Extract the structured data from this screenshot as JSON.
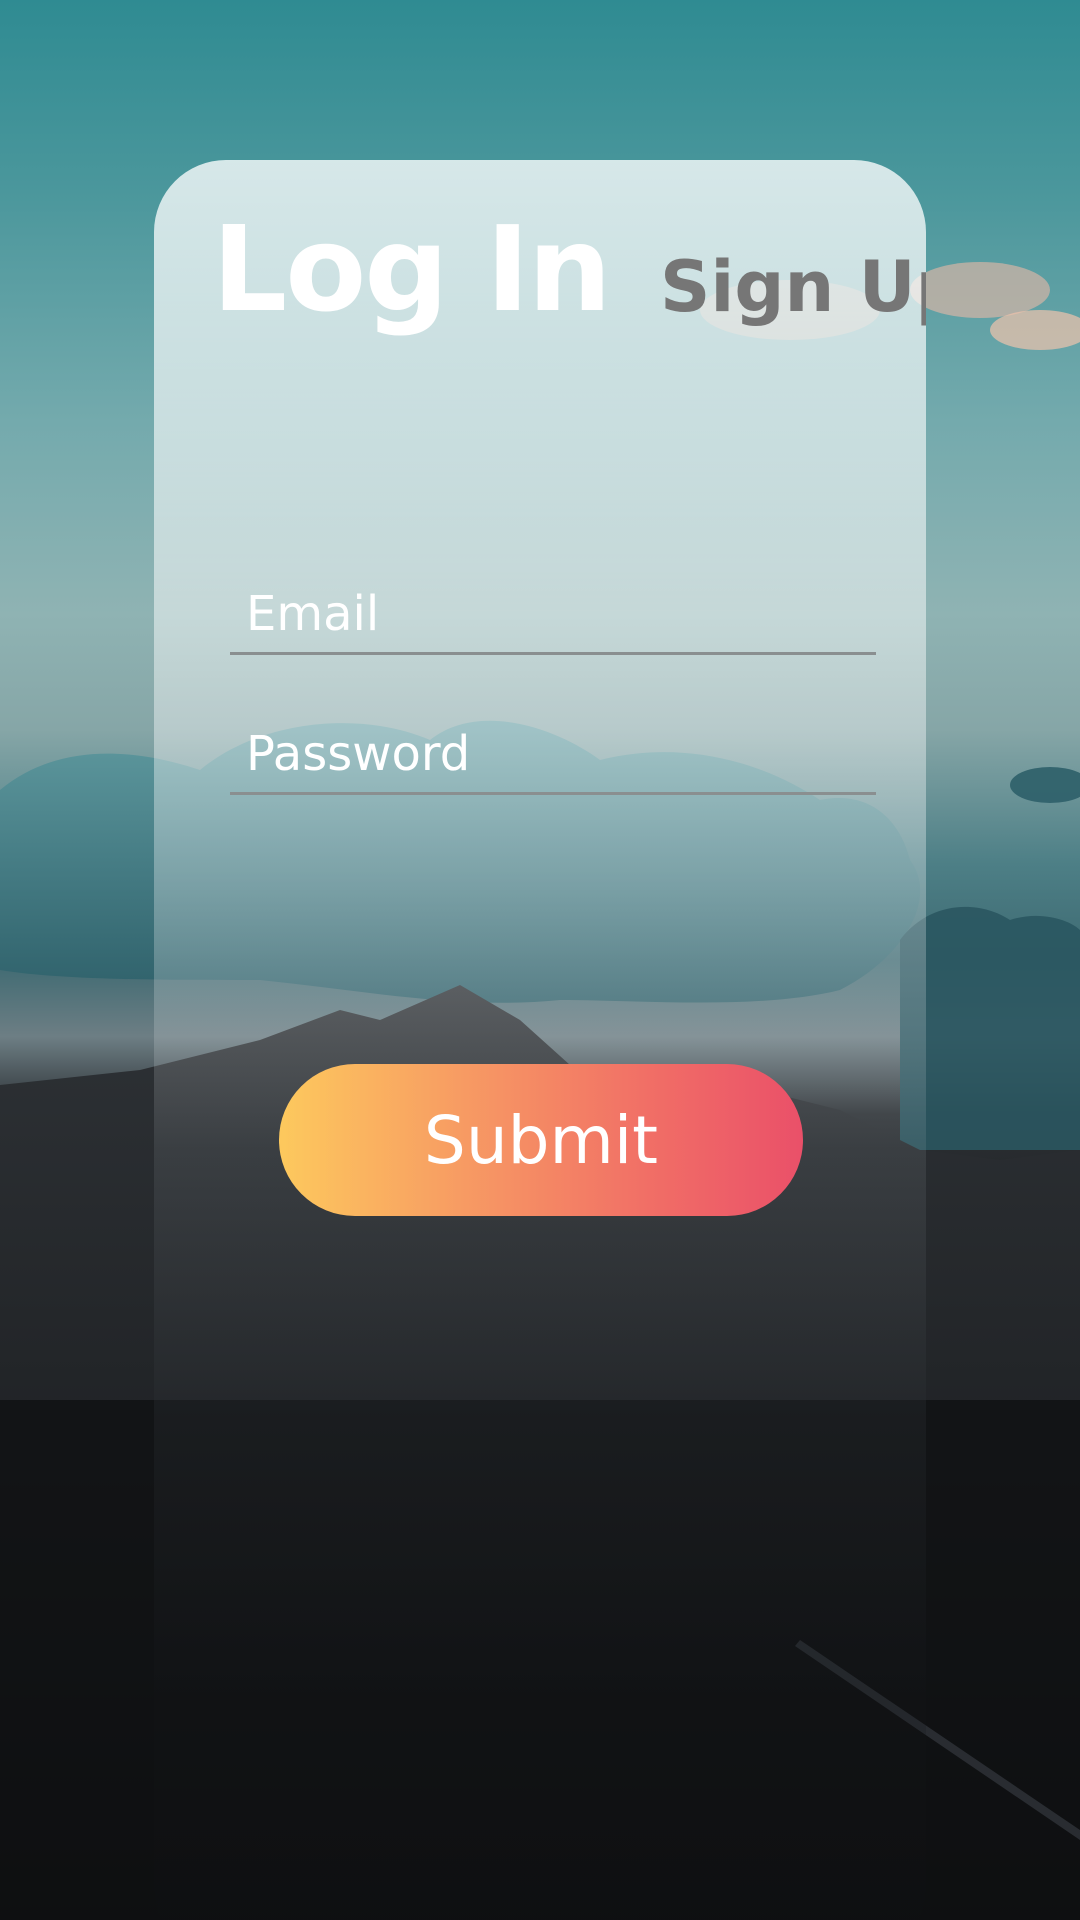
{
  "tabs": {
    "login_label": "Log In",
    "signup_label": "Sign Up"
  },
  "form": {
    "email_placeholder": "Email",
    "password_placeholder": "Password",
    "submit_label": "Submit"
  },
  "colors": {
    "submit_gradient_start": "#fdc95d",
    "submit_gradient_end": "#ea5069",
    "active_tab": "#ffffff",
    "inactive_tab": "#767676"
  }
}
